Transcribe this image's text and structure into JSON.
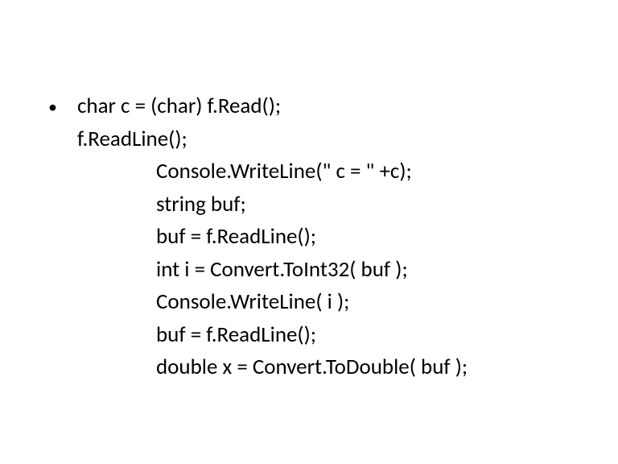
{
  "code": {
    "l1": "char c = (char) f.Read();",
    "l2": "f.ReadLine();",
    "l3": "Console.WriteLine(\" c = \" +c);",
    "l4": "string buf;",
    "l5": "buf = f.ReadLine();",
    "l6": "int i = Convert.ToInt32( buf );",
    "l7": "Console.WriteLine( i );",
    "l8": "buf = f.ReadLine();",
    "l9": "double x = Convert.ToDouble( buf );"
  },
  "bullet": "•"
}
